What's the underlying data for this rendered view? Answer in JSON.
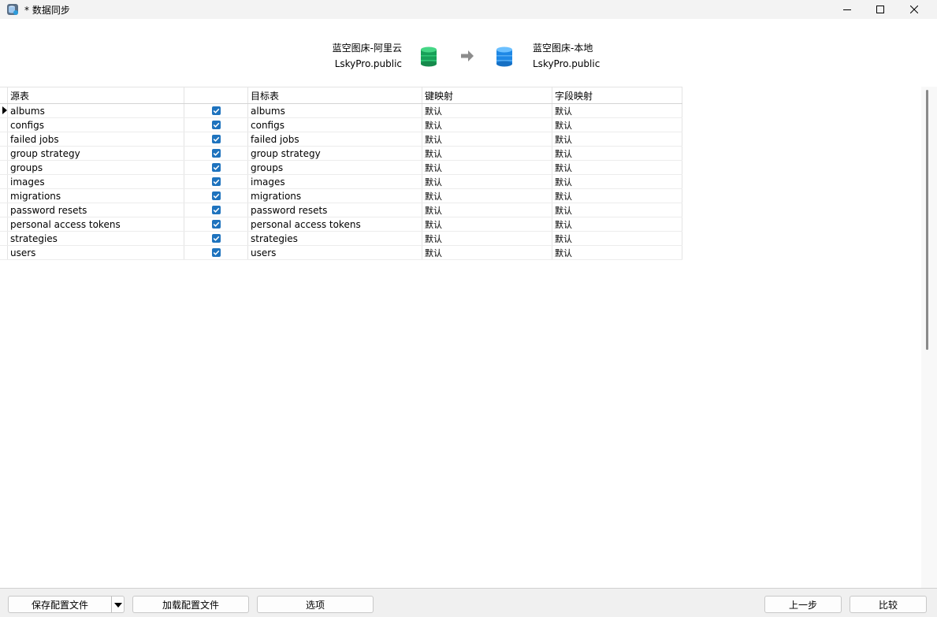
{
  "window": {
    "title": "* 数据同步",
    "icon": "app-db-sync-icon",
    "controls": [
      "minimize-icon",
      "maximize-icon",
      "close-icon"
    ]
  },
  "header": {
    "source": {
      "line1": "蓝空图床-阿里云",
      "line2": "LskyPro.public",
      "icon": "database-green-icon",
      "color": "#1faa5c"
    },
    "target": {
      "line1": "蓝空图床-本地",
      "line2": "LskyPro.public",
      "icon": "database-blue-icon",
      "color": "#1e8fe1"
    },
    "arrow_icon": "arrow-right-icon"
  },
  "grid": {
    "columns": {
      "source": "源表",
      "check": "",
      "target": "目标表",
      "key_map": "键映射",
      "field_map": "字段映射"
    },
    "rows": [
      {
        "source": "albums",
        "checked": true,
        "target": "albums",
        "key_map": "默认",
        "field_map": "默认",
        "current": true
      },
      {
        "source": "configs",
        "checked": true,
        "target": "configs",
        "key_map": "默认",
        "field_map": "默认"
      },
      {
        "source": "failed jobs",
        "checked": true,
        "target": "failed jobs",
        "key_map": "默认",
        "field_map": "默认"
      },
      {
        "source": "group strategy",
        "checked": true,
        "target": "group strategy",
        "key_map": "默认",
        "field_map": "默认"
      },
      {
        "source": "groups",
        "checked": true,
        "target": "groups",
        "key_map": "默认",
        "field_map": "默认"
      },
      {
        "source": "images",
        "checked": true,
        "target": "images",
        "key_map": "默认",
        "field_map": "默认"
      },
      {
        "source": "migrations",
        "checked": true,
        "target": "migrations",
        "key_map": "默认",
        "field_map": "默认"
      },
      {
        "source": "password resets",
        "checked": true,
        "target": "password resets",
        "key_map": "默认",
        "field_map": "默认"
      },
      {
        "source": "personal access tokens",
        "checked": true,
        "target": "personal access tokens",
        "key_map": "默认",
        "field_map": "默认"
      },
      {
        "source": "strategies",
        "checked": true,
        "target": "strategies",
        "key_map": "默认",
        "field_map": "默认"
      },
      {
        "source": "users",
        "checked": true,
        "target": "users",
        "key_map": "默认",
        "field_map": "默认"
      }
    ]
  },
  "footer": {
    "save_config": "保存配置文件",
    "load_config": "加载配置文件",
    "options": "选项",
    "previous": "上一步",
    "compare": "比较"
  }
}
